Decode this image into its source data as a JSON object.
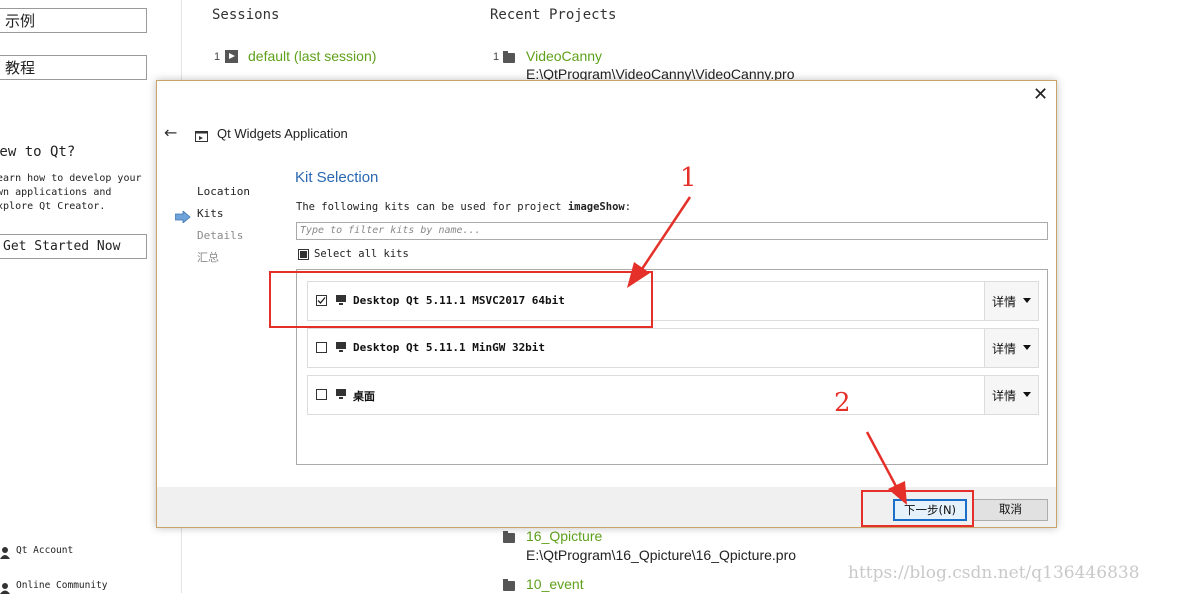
{
  "sidebar": {
    "examples_label": "示例",
    "tutorials_label": "教程",
    "new_title": "New to Qt?",
    "new_desc": "Learn how to develop your\nown applications and\nexplore Qt Creator.",
    "get_started": "Get Started Now",
    "qt_account": "Qt Account",
    "online_community": "Online Community"
  },
  "sessions": {
    "header": "Sessions",
    "items": [
      {
        "num": "1",
        "name": "default (last session)"
      }
    ]
  },
  "recent_projects": {
    "header": "Recent Projects",
    "items": [
      {
        "num": "1",
        "name": "VideoCanny",
        "path": "E:\\QtProgram\\VideoCanny\\VideoCanny.pro"
      },
      {
        "num": "",
        "name": "16_Qpicture",
        "path": "E:\\QtProgram\\16_Qpicture\\16_Qpicture.pro"
      },
      {
        "num": "",
        "name": "10_event",
        "path": ""
      }
    ]
  },
  "dialog": {
    "title": "Qt Widgets Application",
    "steps": [
      "Location",
      "Kits",
      "Details",
      "汇总"
    ],
    "active_step": "Kits",
    "heading": "Kit Selection",
    "intro_prefix": "The following kits can be used for project ",
    "project_name": "imageShow",
    "intro_suffix": ":",
    "filter_placeholder": "Type to filter kits by name...",
    "select_all": "Select all kits",
    "kits": [
      {
        "label": "Desktop Qt 5.11.1 MSVC2017 64bit",
        "checked": true,
        "details": "详情"
      },
      {
        "label": "Desktop Qt 5.11.1 MinGW 32bit",
        "checked": false,
        "details": "详情"
      },
      {
        "label": "桌面",
        "checked": false,
        "details": "详情"
      }
    ],
    "next_button": "下一步(N)",
    "cancel_button": "取消"
  },
  "annotations": {
    "marker_1": "1",
    "marker_2": "2",
    "color": "#e5302a"
  },
  "watermark": "https://blog.csdn.net/q136446838"
}
